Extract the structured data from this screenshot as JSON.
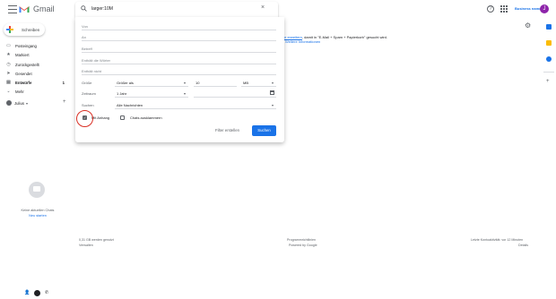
{
  "header": {
    "app_name": "Gmail",
    "brand": "Business name",
    "avatar_letter": "J",
    "help_icon": "help-icon",
    "apps_icon": "apps-icon",
    "settings_icon": "gear-icon"
  },
  "compose": {
    "label": "Schreiben"
  },
  "sidebar": {
    "items": [
      {
        "label": "Posteingang",
        "icon": "inbox-icon",
        "count": "",
        "bold": false
      },
      {
        "label": "Markiert",
        "icon": "star-icon",
        "count": "",
        "bold": false
      },
      {
        "label": "Zurückgestellt",
        "icon": "clock-icon",
        "count": "",
        "bold": false
      },
      {
        "label": "Gesendet",
        "icon": "send-icon",
        "count": "",
        "bold": false
      },
      {
        "label": "Entwürfe",
        "icon": "draft-icon",
        "count": "1",
        "bold": true
      },
      {
        "label": "Mehr",
        "icon": "chevron-down-icon",
        "count": "",
        "bold": false
      }
    ],
    "user": "Julius",
    "add_label": "+"
  },
  "chat": {
    "empty": "Keine aktuellen Chats",
    "start": "Neu starten"
  },
  "main": {
    "info_link": "te erweitern",
    "info_text": ", damit in \"E-Mail + Spam + Papierkorb\" gesucht wird.",
    "more_link": "Weitere Informationen"
  },
  "footer": {
    "storage": "0,31 GB werden genutzt",
    "manage": "Verwalten",
    "policies": "Programmrichtlinien",
    "powered": "Powered by Google",
    "activity": "Letzte Kontoaktivität: vor 12 Minuten",
    "details": "Details"
  },
  "search": {
    "query": "larger:10M",
    "close": "×"
  },
  "advanced": {
    "from": "Von",
    "to": "An",
    "subject": "Betreff",
    "has_words": "Enthält die Wörter",
    "not_words": "Enthält nicht",
    "size_label": "Größe",
    "size_op": "Größer als",
    "size_value": "10",
    "size_unit": "MB",
    "date_label": "Zeitraum",
    "date_value": "1 Jahr",
    "search_label": "Suchen",
    "search_value": "Alle Nachrichten",
    "has_attachment": "Mit Anhang",
    "has_attachment_checked": true,
    "exclude_chats": "Chats ausklammern",
    "exclude_chats_checked": false,
    "create_filter": "Filter erstellen",
    "submit": "Suchen"
  }
}
